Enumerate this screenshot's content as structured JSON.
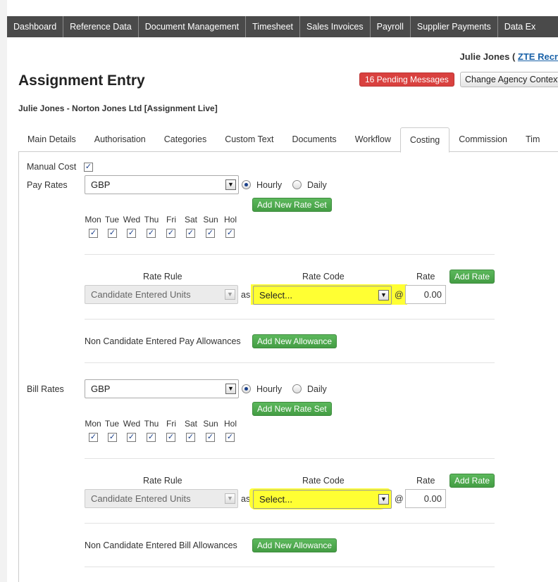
{
  "nav": {
    "items": [
      "Dashboard",
      "Reference Data",
      "Document Management",
      "Timesheet",
      "Sales Invoices",
      "Payroll",
      "Supplier Payments",
      "Data Ex"
    ]
  },
  "header": {
    "user_name": "Julie Jones (",
    "context_link": "ZTE Recr",
    "page_title": "Assignment Entry",
    "pending_messages": "16 Pending Messages",
    "change_context": "Change Agency Context",
    "subtitle": "Julie Jones - Norton Jones Ltd [Assignment Live]"
  },
  "tabs": [
    "Main Details",
    "Authorisation",
    "Categories",
    "Custom Text",
    "Documents",
    "Workflow",
    "Costing",
    "Commission",
    "Tim"
  ],
  "active_tab": "Costing",
  "costing": {
    "manual_cost_label": "Manual Cost",
    "manual_cost_checked": true,
    "pay": {
      "label": "Pay Rates",
      "currency": "GBP",
      "hourly_label": "Hourly",
      "daily_label": "Daily",
      "selected_period": "Hourly",
      "add_rate_set": "Add New Rate Set",
      "days": [
        "Mon",
        "Tue",
        "Wed",
        "Thu",
        "Fri",
        "Sat",
        "Sun",
        "Hol"
      ],
      "rate_rule_header": "Rate Rule",
      "rate_code_header": "Rate Code",
      "rate_header": "Rate",
      "add_rate": "Add Rate",
      "rate_rule_value": "Candidate Entered Units",
      "as_label": "as",
      "rate_code_value": "Select...",
      "at_label": "@",
      "rate_value": "0.00",
      "allowances_label": "Non Candidate Entered Pay Allowances",
      "add_allowance": "Add New Allowance"
    },
    "bill": {
      "label": "Bill Rates",
      "currency": "GBP",
      "hourly_label": "Hourly",
      "daily_label": "Daily",
      "selected_period": "Hourly",
      "add_rate_set": "Add New Rate Set",
      "days": [
        "Mon",
        "Tue",
        "Wed",
        "Thu",
        "Fri",
        "Sat",
        "Sun",
        "Hol"
      ],
      "rate_rule_header": "Rate Rule",
      "rate_code_header": "Rate Code",
      "rate_header": "Rate",
      "add_rate": "Add Rate",
      "rate_rule_value": "Candidate Entered Units",
      "as_label": "as",
      "rate_code_value": "Select...",
      "at_label": "@",
      "rate_value": "0.00",
      "allowances_label": "Non Candidate Entered Bill Allowances",
      "add_allowance": "Add New Allowance"
    }
  },
  "colors": {
    "nav_bg": "#4a4a4a",
    "danger": "#d9413f",
    "success": "#5cb85c",
    "highlight": "#ffff33",
    "link": "#1a62a8"
  }
}
